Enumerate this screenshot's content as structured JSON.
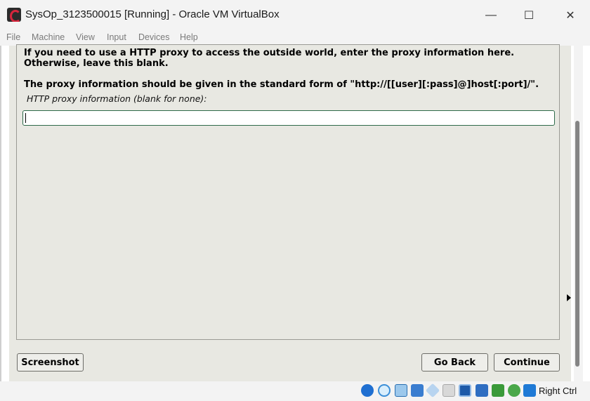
{
  "window": {
    "title": "SysOp_3123500015 [Running] - Oracle VM VirtualBox",
    "minimize_glyph": "—",
    "maximize_glyph": "☐",
    "close_glyph": "✕"
  },
  "menubar": [
    "File",
    "Machine",
    "View",
    "Input",
    "Devices",
    "Help"
  ],
  "installer": {
    "paragraph1": "If you need to use a HTTP proxy to access the outside world, enter the proxy information here. Otherwise, leave this blank.",
    "paragraph2": "The proxy information should be given in the standard form of \"http://[[user][:pass]@]host[:port]/\".",
    "prompt": "HTTP proxy information (blank for none):",
    "input_value": "",
    "screenshot_button": "Screenshot",
    "go_back_button": "Go Back",
    "continue_button": "Continue"
  },
  "statusbar": {
    "icons": [
      "hard-disk-icon",
      "optical-disk-icon",
      "audio-icon",
      "network-icon",
      "usb-icon",
      "shared-folders-icon",
      "display-icon",
      "video-capture-icon",
      "recording-icon",
      "cpu-icon",
      "mouse-integration-icon",
      "keyboard-icon"
    ],
    "host_key": "Right Ctrl"
  }
}
